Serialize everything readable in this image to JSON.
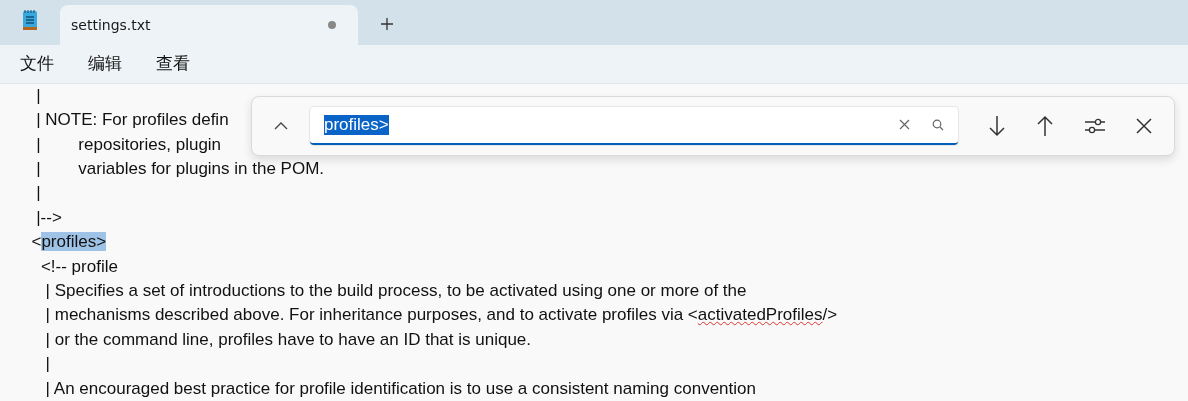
{
  "tabs": [
    {
      "label": "settings.txt",
      "selected": true,
      "modified": true
    }
  ],
  "menu": [
    "文件",
    "编辑",
    "查看"
  ],
  "lines": [
    [
      {
        "text": "   |"
      }
    ],
    [
      {
        "text": "   | NOTE: For profiles defin"
      }
    ],
    [
      {
        "text": "   |        repositories, plugin"
      }
    ],
    [
      {
        "text": "   |        variables for plugins in the POM."
      }
    ],
    [
      {
        "text": "   |"
      }
    ],
    [
      {
        "text": "   |-->"
      }
    ],
    [
      {
        "text": "  <"
      },
      {
        "text": "profiles>",
        "highlighted": true
      }
    ],
    [
      {
        "text": "    <!-- profile"
      }
    ],
    [
      {
        "text": "     | Specifies a set of introductions to the build process, to be activated using one or more of the"
      }
    ],
    [
      {
        "text": "     | mechanisms described above. For inheritance purposes, and to activate profiles via <"
      },
      {
        "text": "activatedProfiles",
        "misspelled": true
      },
      {
        "text": "/>"
      }
    ],
    [
      {
        "text": "     | or the command line, profiles have to have an ID that is unique."
      }
    ],
    [
      {
        "text": "     |"
      }
    ],
    [
      {
        "text": "     | An encouraged best practice for profile identification is to use a consistent naming convention"
      }
    ]
  ],
  "find": {
    "value": "profiles>",
    "value_selected": true
  }
}
